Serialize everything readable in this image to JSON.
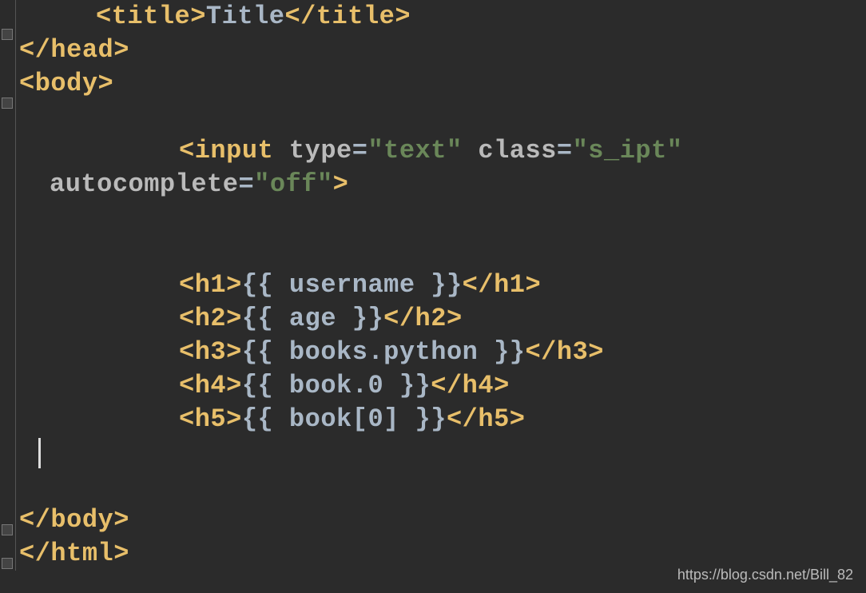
{
  "code": {
    "title_open": "<title>",
    "title_text": "Title",
    "title_close": "</title>",
    "head_close": "</head>",
    "body_open": "<body>",
    "input_open": "<input",
    "input_type_attr": "type",
    "input_type_val": "\"text\"",
    "input_class_attr": "class",
    "input_class_val": "\"s_ipt\"",
    "input_autocomplete_attr": "autocomplete",
    "input_autocomplete_val": "\"off\"",
    "input_close": ">",
    "h1_open": "<h1>",
    "h1_content": "{{ username }}",
    "h1_close": "</h1>",
    "h2_open": "<h2>",
    "h2_content": "{{ age }}",
    "h2_close": "</h2>",
    "h3_open": "<h3>",
    "h3_content": "{{ books.python }}",
    "h3_close": "</h3>",
    "h4_open": "<h4>",
    "h4_content": "{{ book.0 }}",
    "h4_close": "</h4>",
    "h5_open": "<h5>",
    "h5_content": "{{ book[0] }}",
    "h5_close": "</h5>",
    "body_close": "</body>",
    "html_close": "</html>"
  },
  "watermark": "https://blog.csdn.net/Bill_82"
}
